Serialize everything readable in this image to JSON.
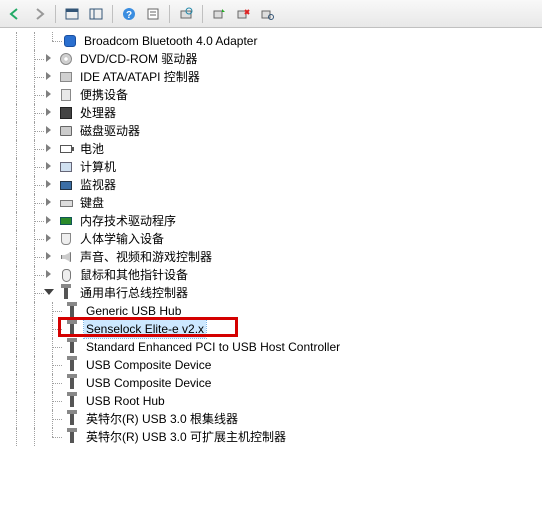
{
  "toolbar": {
    "buttons": [
      "back",
      "forward",
      "show-console",
      "show-tree",
      "help",
      "properties",
      "scan",
      "update",
      "uninstall",
      "view"
    ]
  },
  "tree": {
    "top_item": "Broadcom Bluetooth 4.0 Adapter",
    "items": [
      {
        "label": "DVD/CD-ROM 驱动器",
        "icon": "cd"
      },
      {
        "label": "IDE ATA/ATAPI 控制器",
        "icon": "ide"
      },
      {
        "label": "便携设备",
        "icon": "dev"
      },
      {
        "label": "处理器",
        "icon": "cpu"
      },
      {
        "label": "磁盘驱动器",
        "icon": "disk"
      },
      {
        "label": "电池",
        "icon": "bat"
      },
      {
        "label": "计算机",
        "icon": "pc"
      },
      {
        "label": "监视器",
        "icon": "mon"
      },
      {
        "label": "键盘",
        "icon": "kb"
      },
      {
        "label": "内存技术驱动程序",
        "icon": "mem"
      },
      {
        "label": "人体学输入设备",
        "icon": "hid"
      },
      {
        "label": "声音、视频和游戏控制器",
        "icon": "snd"
      },
      {
        "label": "鼠标和其他指针设备",
        "icon": "ms"
      }
    ],
    "usb_category": "通用串行总线控制器",
    "usb_children": [
      "Generic USB Hub",
      "Senselock Elite-e v2.x",
      "Standard Enhanced PCI to USB Host Controller",
      "USB Composite Device",
      "USB Composite Device",
      "USB Root Hub",
      "英特尔(R) USB 3.0 根集线器",
      "英特尔(R) USB 3.0 可扩展主机控制器"
    ]
  },
  "highlighted_index": 1
}
